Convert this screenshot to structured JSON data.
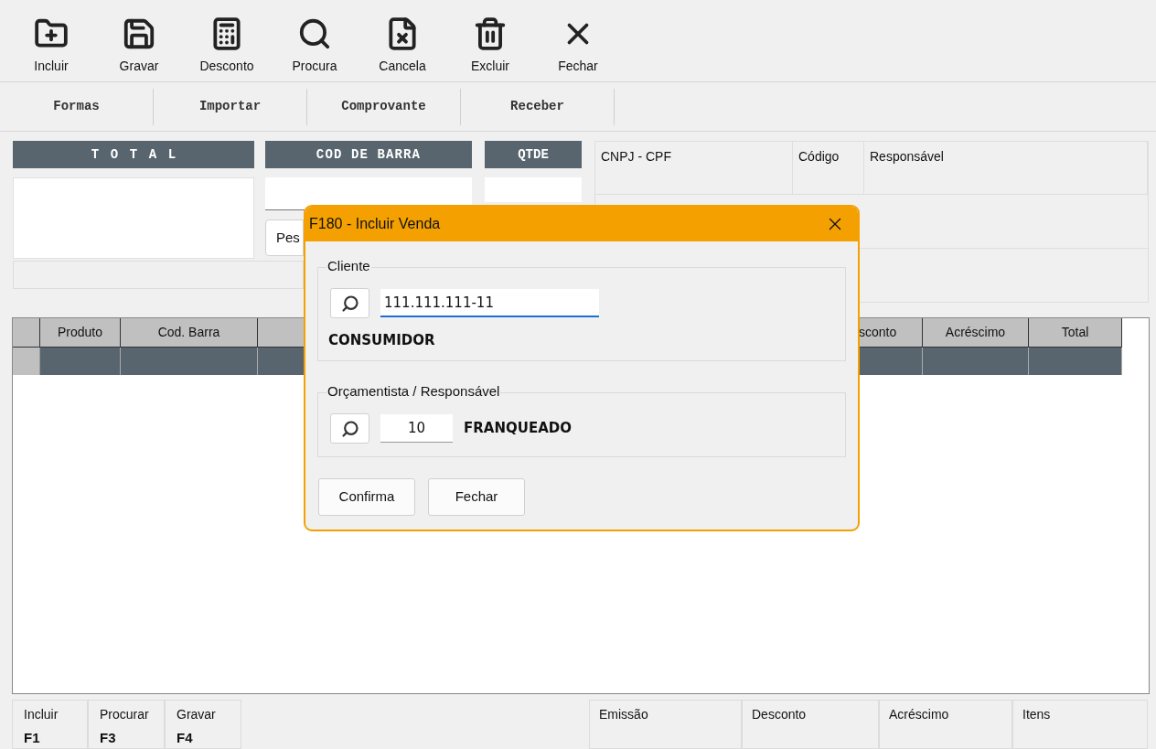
{
  "toolbar": [
    {
      "label": "Incluir"
    },
    {
      "label": "Gravar"
    },
    {
      "label": "Desconto"
    },
    {
      "label": "Procura"
    },
    {
      "label": "Cancela"
    },
    {
      "label": "Excluir"
    },
    {
      "label": "Fechar"
    }
  ],
  "actions": [
    {
      "label": "Formas"
    },
    {
      "label": "Importar"
    },
    {
      "label": "Comprovante"
    },
    {
      "label": "Receber"
    }
  ],
  "entry": {
    "total_header": "TOTAL",
    "barcode_header": "COD DE BARRA",
    "qty_header": "QTDE",
    "search_button": "Pes"
  },
  "info_panel": {
    "fields": [
      "CNPJ - CPF",
      "Código",
      "Responsável"
    ]
  },
  "grid": {
    "columns": [
      {
        "label": "Produto"
      },
      {
        "label": "Cod. Barra"
      },
      {},
      {
        "label": "sconto"
      },
      {
        "label": "Acréscimo"
      },
      {
        "label": "Total"
      }
    ]
  },
  "shortcuts": [
    {
      "label": "Incluir",
      "key": "F1"
    },
    {
      "label": "Procurar",
      "key": "F3"
    },
    {
      "label": "Gravar",
      "key": "F4"
    }
  ],
  "totals": [
    "Emissão",
    "Desconto",
    "Acréscimo",
    "Itens"
  ],
  "dialog": {
    "title": "F180 - Incluir Venda",
    "cliente": {
      "legend": "Cliente",
      "value": "111.111.111-11",
      "name": "CONSUMIDOR"
    },
    "responsavel": {
      "legend": "Orçamentista / Responsável",
      "value": "10",
      "name": "FRANQUEADO"
    },
    "buttons": [
      "Confirma",
      "Fechar"
    ]
  }
}
